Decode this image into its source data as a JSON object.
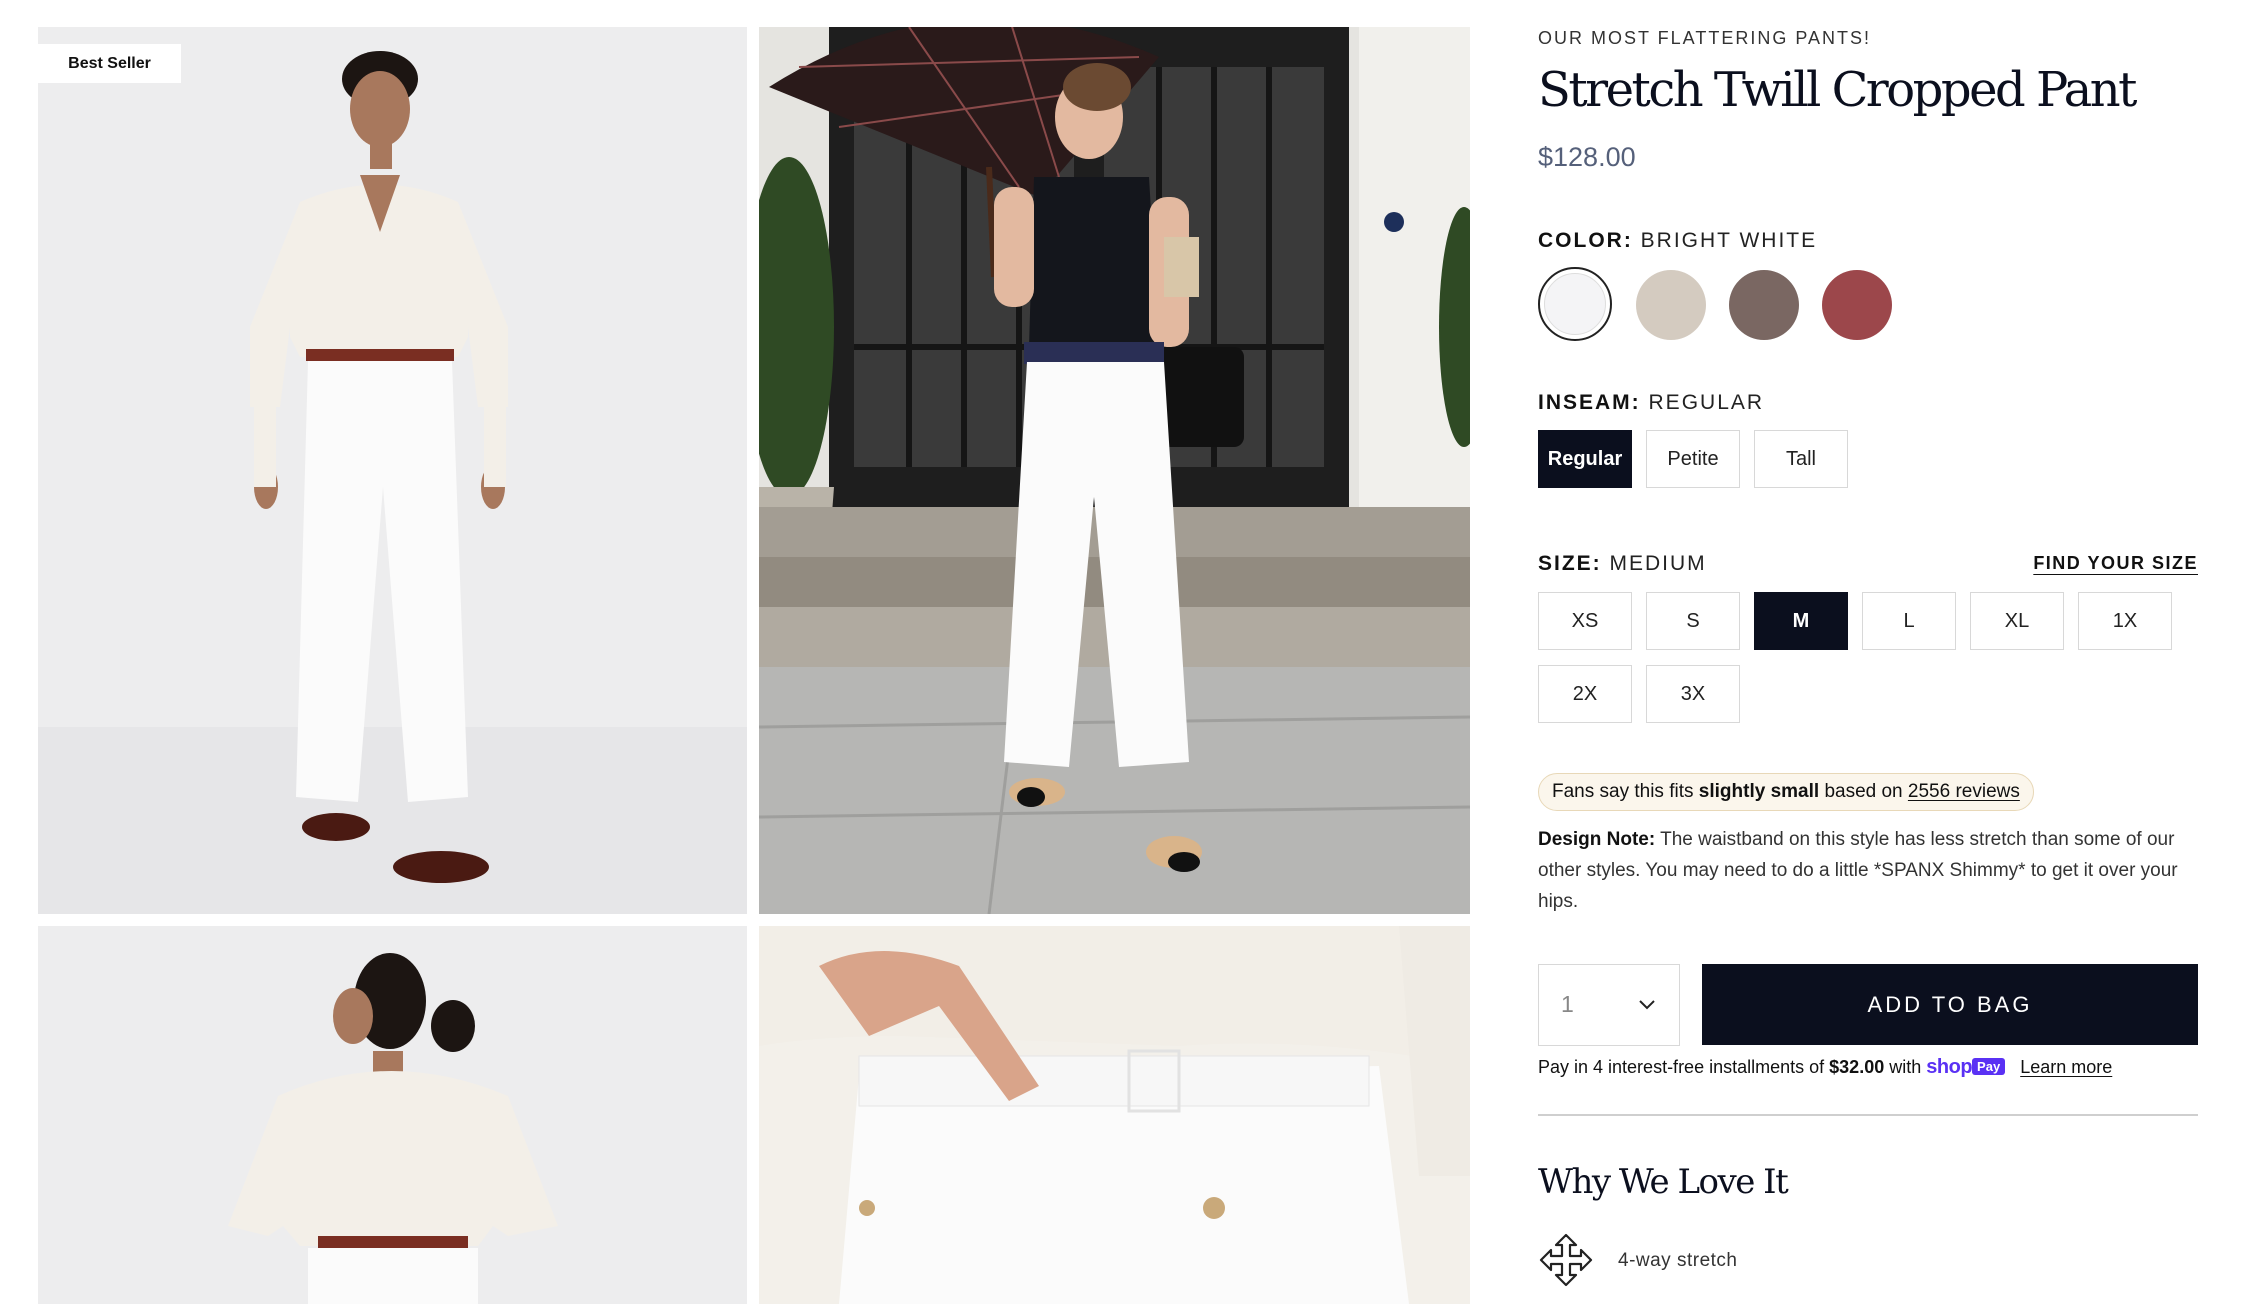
{
  "gallery": {
    "badge": "Best Seller",
    "images": [
      {
        "name": "model-front-photo"
      },
      {
        "name": "street-style-photo"
      },
      {
        "name": "model-back-photo"
      },
      {
        "name": "waistband-detail-photo"
      }
    ]
  },
  "product": {
    "eyebrow": "OUR MOST FLATTERING PANTS!",
    "title": "Stretch Twill Cropped Pant",
    "price": "$128.00"
  },
  "color": {
    "label": "COLOR:",
    "value": "BRIGHT WHITE",
    "swatches": [
      {
        "name": "Bright White",
        "hex": "#f4f4f6",
        "selected": true
      },
      {
        "name": "Beige",
        "hex": "#d4cbc0",
        "selected": false
      },
      {
        "name": "Brown",
        "hex": "#7a6762",
        "selected": false
      },
      {
        "name": "Red",
        "hex": "#9c474b",
        "selected": false
      }
    ]
  },
  "inseam": {
    "label": "INSEAM:",
    "value": "REGULAR",
    "options": [
      "Regular",
      "Petite",
      "Tall"
    ],
    "selected": "Regular"
  },
  "size": {
    "label": "SIZE:",
    "value": "MEDIUM",
    "find_size": "FIND YOUR SIZE",
    "options": [
      "XS",
      "S",
      "M",
      "L",
      "XL",
      "1X",
      "2X",
      "3X"
    ],
    "selected": "M"
  },
  "fit": {
    "prefix": "Fans say this fits",
    "emphasis": "slightly small",
    "middle": "based on",
    "reviews_link": "2556 reviews"
  },
  "design_note": {
    "label": "Design Note:",
    "text": "The waistband on this style has less stretch than some of our other styles. You may need to do a little *SPANX Shimmy* to get it over your hips."
  },
  "purchase": {
    "quantity": "1",
    "add_to_bag": "ADD TO BAG",
    "installments_prefix": "Pay in 4 interest-free installments of",
    "installment_amount": "$32.00",
    "with": "with",
    "shop_word": "shop",
    "pay_word": "Pay",
    "learn_more": "Learn more"
  },
  "why": {
    "title": "Why We Love It",
    "features": [
      {
        "icon": "four-way-arrows-icon",
        "text": "4-way stretch"
      }
    ]
  },
  "colors": {
    "navy": "#0b0f1e",
    "shop_pay_purple": "#5a31f4",
    "fit_pill_bg": "#fbf6ec"
  }
}
